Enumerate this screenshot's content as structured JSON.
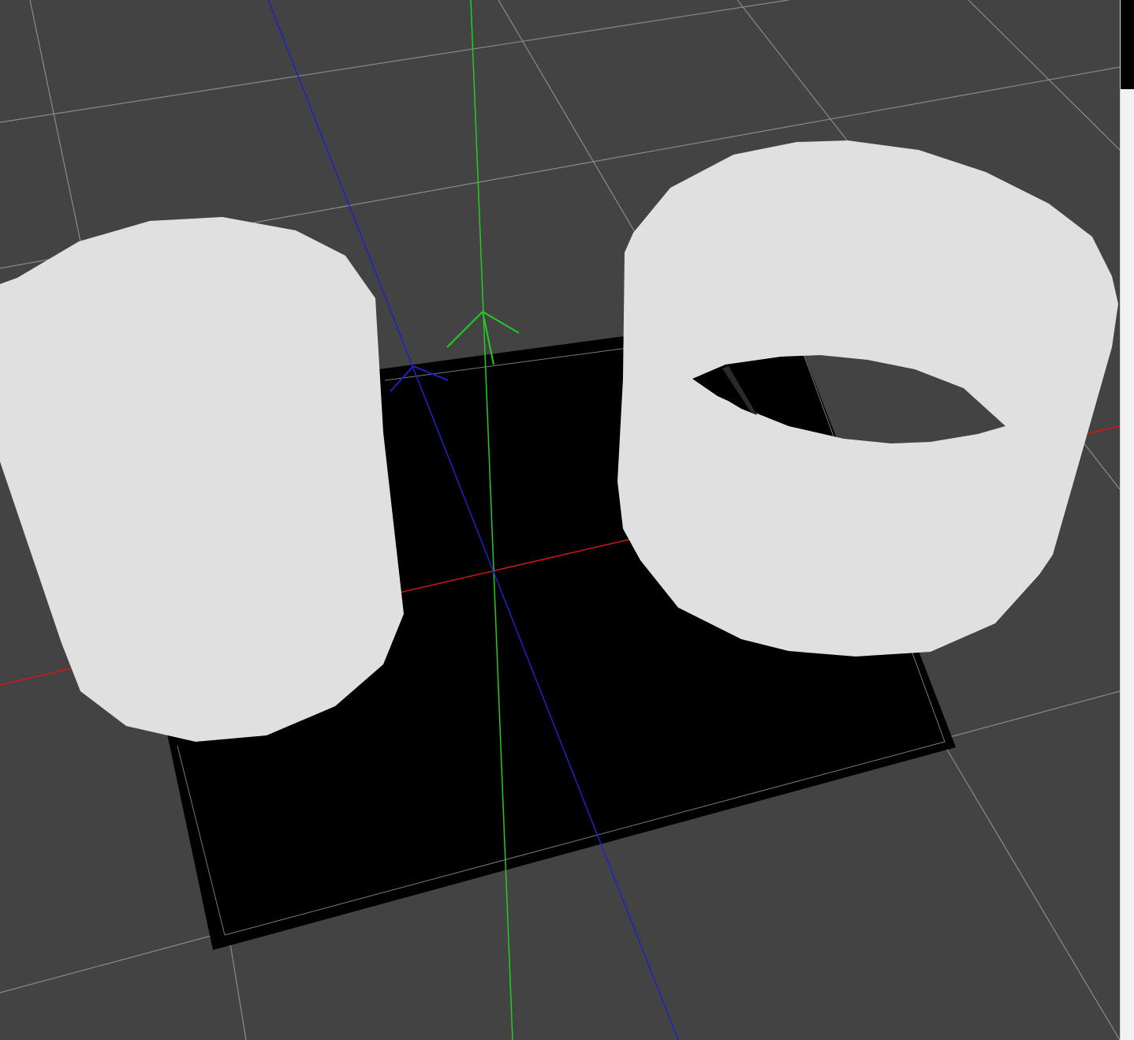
{
  "viewport": {
    "background_color": "#434343",
    "grid_color": "#8a8a8a",
    "ground_plane_color": "#000000",
    "object_color": "#e0e0e0"
  },
  "axes": {
    "x_axis_color": "#d01818",
    "y_axis_color": "#22cc22",
    "z_axis_color": "#2020c8"
  },
  "objects": [
    {
      "name": "solid-cylinder",
      "shape": "cylinder"
    },
    {
      "name": "hollow-cylinder",
      "shape": "tube"
    }
  ],
  "scrollbar": {
    "thumb_color": "#000000",
    "track_color": "#f2f2f2"
  }
}
